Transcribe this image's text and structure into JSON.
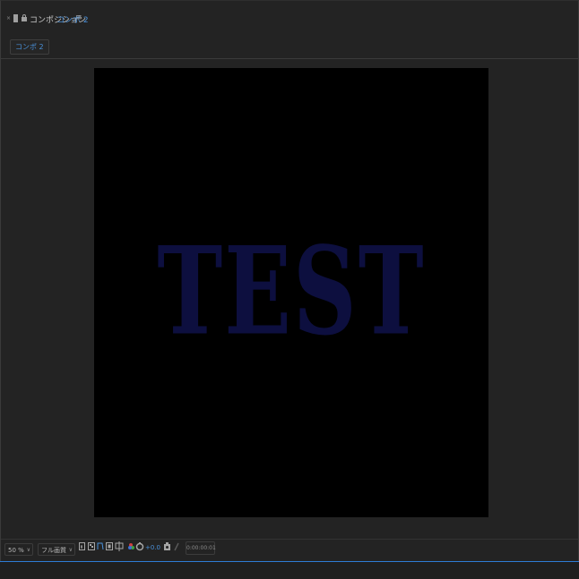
{
  "header": {
    "title_prefix": "コンポジション",
    "composition_name": "コンポ 2",
    "menu_icon": "hamburger-menu-icon"
  },
  "tabs": [
    {
      "label": "コンポ 2",
      "active": true
    }
  ],
  "canvas": {
    "text": "TEST",
    "background": "#000000",
    "text_color": "#0d0f3f"
  },
  "toolbar": {
    "zoom": "50 %",
    "resolution": "フル画質",
    "exposure_value": "+0.0",
    "timecode": "0:00:00:01"
  },
  "colors": {
    "accent": "#4a90d9",
    "panel_bg": "#232323",
    "focus_border": "#2d7bd5"
  }
}
